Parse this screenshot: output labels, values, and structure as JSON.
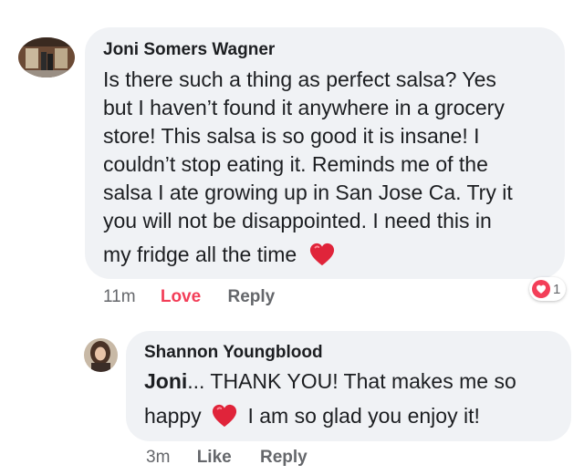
{
  "comment": {
    "author": "Joni Somers Wagner",
    "lines": [
      "Is there such a thing as perfect salsa? Yes",
      "but I haven’t found it anywhere in a grocery",
      "store! This salsa is so good it is insane! I",
      "couldn’t stop eating it. Reminds me of the",
      "salsa I ate growing up in San Jose Ca. Try it",
      "you will not be disappointed. I need this in",
      "my fridge all the time"
    ],
    "emoji_icon": "red-heart",
    "time": "11m",
    "reaction_label": "Love",
    "reply_label": "Reply",
    "reaction_count": "1",
    "reaction_icon": "love-reaction"
  },
  "reply": {
    "author": "Shannon Youngblood",
    "line1_bold": "Joni",
    "line1_rest": "... THANK YOU!  That makes me so",
    "line2_start": "happy",
    "line2_end": "I am so glad you enjoy it!",
    "emoji_icon": "red-heart",
    "time": "3m",
    "like_label": "Like",
    "reply_label": "Reply"
  },
  "colors": {
    "bubble": "#f0f2f5",
    "love": "#f33e58",
    "meta": "#65676b",
    "heart": "#e0243a"
  }
}
